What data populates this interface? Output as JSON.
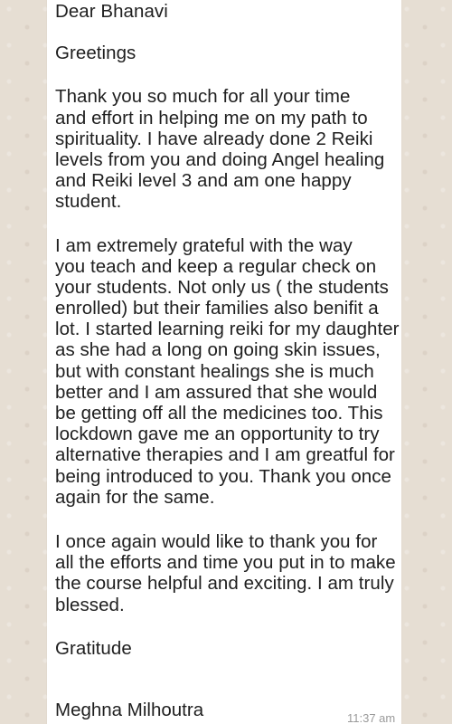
{
  "chat": {
    "message": {
      "salutation": "Dear Bhanavi",
      "greeting": "Greetings",
      "paragraph1": [
        "Thank you so much for all your time",
        "and effort in helping me on my path to",
        "spirituality. I have already done 2 Reiki",
        "levels from you and doing Angel healing",
        "and Reiki level 3 and am one happy",
        "student."
      ],
      "paragraph2": [
        "I am extremely grateful with the way",
        "you teach and keep a regular check on",
        "your students. Not only us ( the students",
        "enrolled) but their families also benifit a",
        "lot.  I started learning reiki for my daughter",
        "as she had a long on going skin issues,",
        "but with constant healings she is much",
        "better and I am assured that she would",
        "be getting off all the medicines too. This",
        "lockdown gave me an opportunity to try",
        "alternative therapies and I am greatful for",
        "being introduced to you. Thank you once",
        "again for the same."
      ],
      "paragraph3": [
        "I once again would like to thank you for",
        "all the efforts and time you put in to make",
        "the course helpful and exciting. I am truly",
        "blessed."
      ],
      "closing": "Gratitude",
      "signature": "Meghna Milhoutra",
      "timestamp": "11:37 am"
    }
  }
}
